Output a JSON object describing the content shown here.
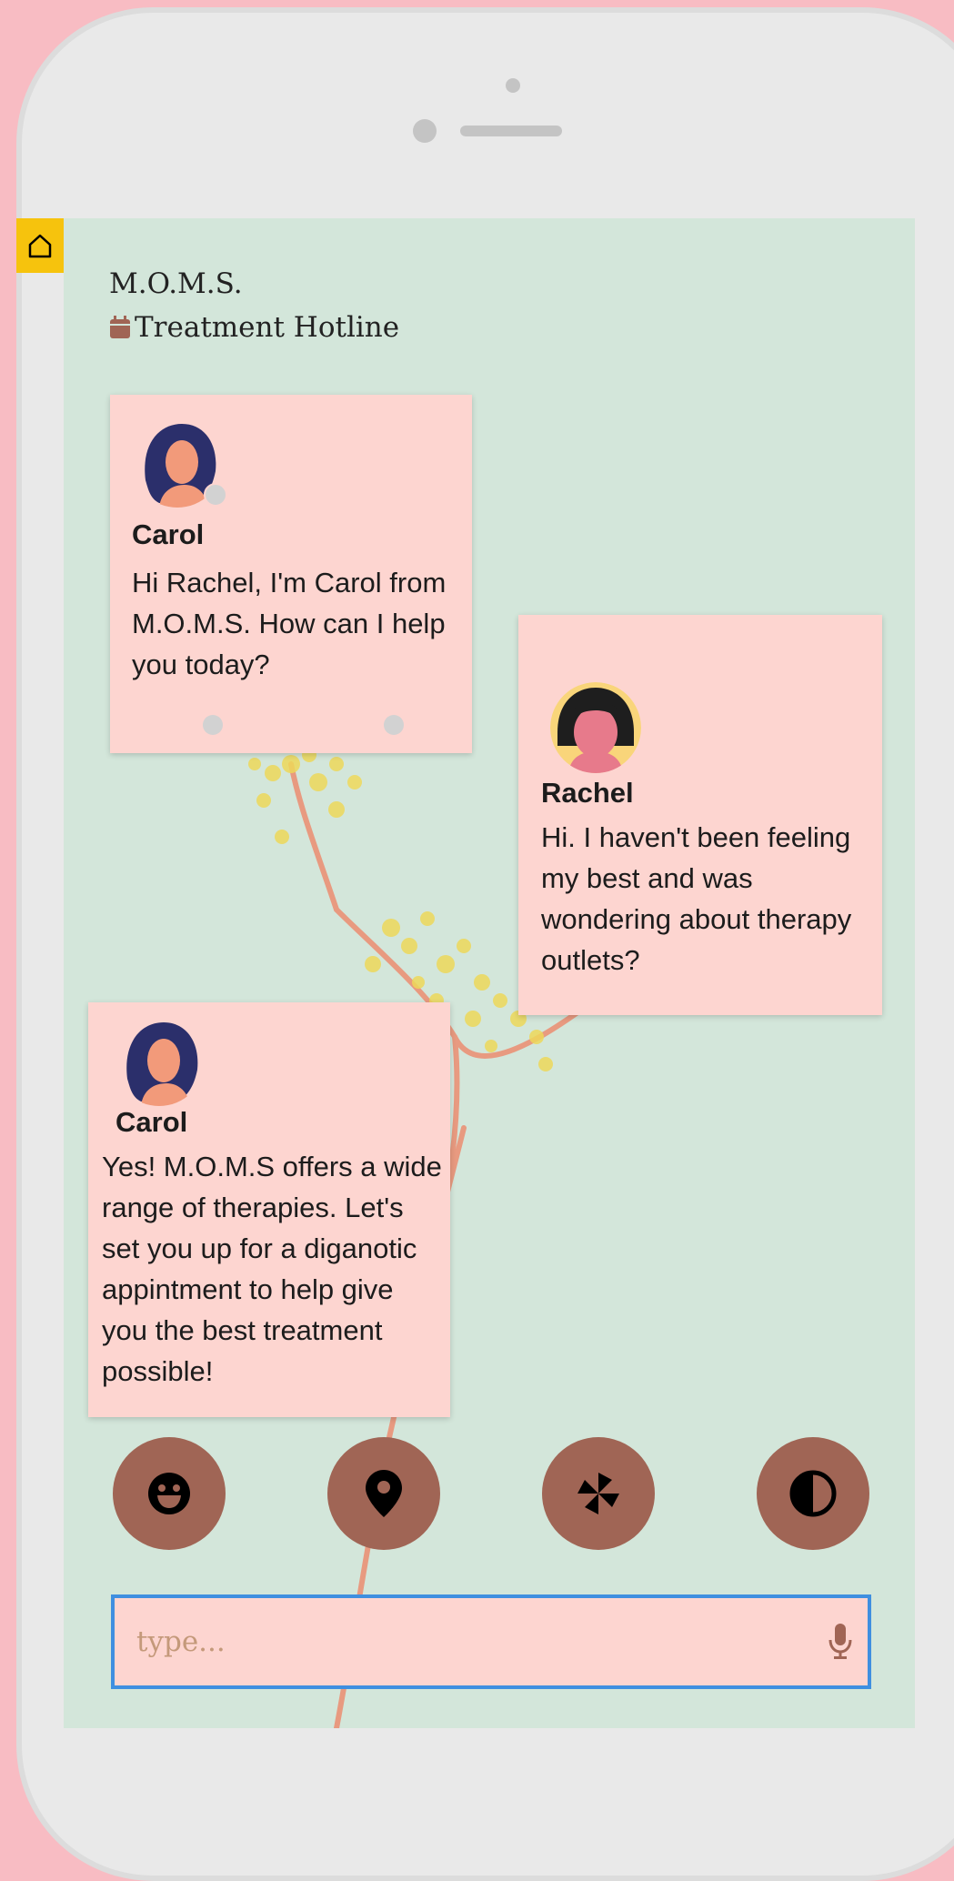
{
  "app": {
    "brand": "M.O.M.S.",
    "subtitle": "Treatment Hotline",
    "subtitle_icon": "calendar-icon",
    "home_icon": "home-icon"
  },
  "chat": {
    "messages": [
      {
        "sender": "Carol",
        "text": "Hi Rachel, I'm Carol from M.O.M.S. How can I help you today?",
        "avatar": "carol-avatar"
      },
      {
        "sender": "Rachel",
        "text": "Hi. I haven't been feeling my best and was wondering about therapy outlets?",
        "avatar": "rachel-avatar"
      },
      {
        "sender": "Carol",
        "text": "Yes! M.O.M.S offers a wide range of therapies. Let's set you up for a diganotic appintment to help give you the best treatment possible!",
        "avatar": "carol-avatar"
      }
    ]
  },
  "actions": [
    {
      "icon": "smile-icon"
    },
    {
      "icon": "location-pin-icon"
    },
    {
      "icon": "pinwheel-icon"
    },
    {
      "icon": "contrast-icon"
    }
  ],
  "composer": {
    "placeholder": "type...",
    "value": "",
    "mic_icon": "microphone-icon"
  },
  "colors": {
    "screen_bg": "#d3e6da",
    "bubble_bg": "#fdd5d0",
    "action_btn": "#a06555",
    "home_btn": "#f6c30d",
    "input_border": "#3f8fe0",
    "page_bg": "#f8bcc3"
  }
}
